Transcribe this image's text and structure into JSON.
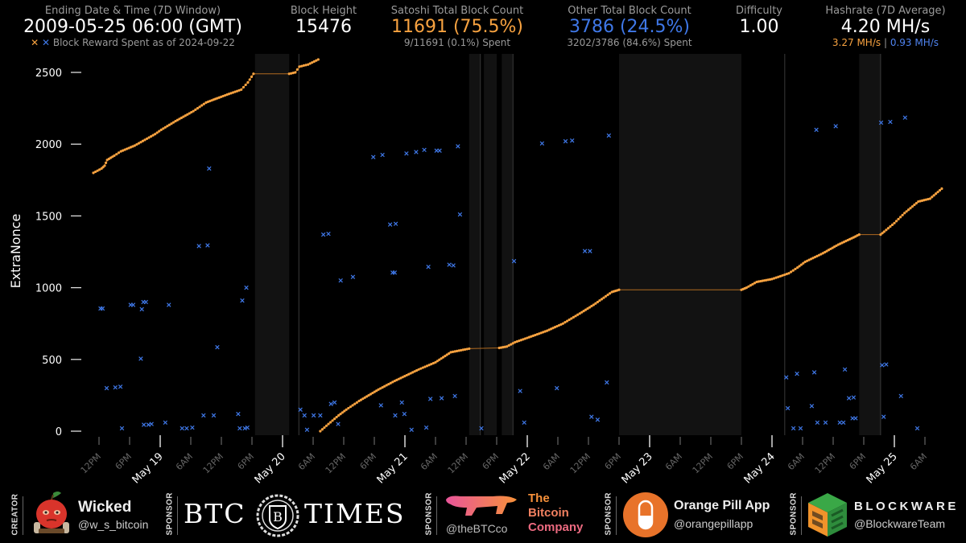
{
  "header": {
    "ending": {
      "label": "Ending Date & Time (7D Window)",
      "value": "2009-05-25 06:00 (GMT)",
      "legend": "Block Reward Spent as of 2024-09-22"
    },
    "block_height": {
      "label": "Block Height",
      "value": "15476"
    },
    "satoshi": {
      "label": "Satoshi Total Block Count",
      "value": "11691 (75.5%)",
      "sub": "9/11691 (0.1%) Spent"
    },
    "other": {
      "label": "Other Total Block Count",
      "value": "3786 (24.5%)",
      "sub": "3202/3786 (84.6%) Spent"
    },
    "difficulty": {
      "label": "Difficulty",
      "value": "1.00"
    },
    "hashrate": {
      "label": "Hashrate (7D Average)",
      "value": "4.20 MH/s",
      "satoshi": "3.27 MH/s",
      "separator": "|",
      "other": "0.93 MH/s"
    }
  },
  "colors": {
    "satoshi": "#f7a240",
    "other": "#3f78e8",
    "band": "#121212",
    "background": "#000000"
  },
  "chart_data": {
    "type": "scatter",
    "title": "",
    "xlabel": "",
    "ylabel": "ExtraNonce",
    "ylim": [
      0,
      2500
    ],
    "yticks": [
      0,
      500,
      1000,
      1500,
      2000,
      2500
    ],
    "x_units": "hours since 2009-05-19 00:00 GMT",
    "xlim": [
      -18,
      156
    ],
    "xticks_major": [
      {
        "h": 0,
        "label": "May 19"
      },
      {
        "h": 24,
        "label": "May 20"
      },
      {
        "h": 48,
        "label": "May 21"
      },
      {
        "h": 72,
        "label": "May 22"
      },
      {
        "h": 96,
        "label": "May 23"
      },
      {
        "h": 120,
        "label": "May 24"
      },
      {
        "h": 144,
        "label": "May 25"
      }
    ],
    "xticks_minor": [
      {
        "h": -12,
        "label": "12PM"
      },
      {
        "h": -6,
        "label": "6PM"
      },
      {
        "h": 6,
        "label": "6AM"
      },
      {
        "h": 12,
        "label": "12PM"
      },
      {
        "h": 18,
        "label": "6PM"
      },
      {
        "h": 30,
        "label": "6AM"
      },
      {
        "h": 36,
        "label": "12PM"
      },
      {
        "h": 42,
        "label": "6PM"
      },
      {
        "h": 54,
        "label": "6AM"
      },
      {
        "h": 60,
        "label": "12PM"
      },
      {
        "h": 66,
        "label": "6PM"
      },
      {
        "h": 78,
        "label": "6AM"
      },
      {
        "h": 84,
        "label": "12PM"
      },
      {
        "h": 90,
        "label": "6PM"
      },
      {
        "h": 102,
        "label": "6AM"
      },
      {
        "h": 108,
        "label": "12PM"
      },
      {
        "h": 114,
        "label": "6PM"
      },
      {
        "h": 126,
        "label": "6AM"
      },
      {
        "h": 132,
        "label": "12PM"
      },
      {
        "h": 138,
        "label": "6PM"
      },
      {
        "h": 150,
        "label": "6AM"
      }
    ],
    "gap_bands": [
      [
        18.6,
        25.3
      ],
      [
        60.6,
        62.7
      ],
      [
        63.5,
        66.0
      ],
      [
        67.0,
        69.2
      ],
      [
        90.0,
        114.0
      ],
      [
        137.1,
        141.3
      ]
    ],
    "vertical_lines": [
      27.2,
      62.8,
      69.2,
      122.5,
      141.3
    ],
    "series": [
      {
        "name": "Satoshi",
        "marker": "dot",
        "color": "#f7a240",
        "segments": [
          [
            [
              -13.1,
              1800
            ],
            [
              -11.5,
              1830
            ],
            [
              -10.9,
              1850
            ],
            [
              -10.4,
              1890
            ],
            [
              -9,
              1920
            ],
            [
              -7.7,
              1950
            ],
            [
              -5,
              1990
            ],
            [
              -3.0,
              2030
            ],
            [
              -1,
              2070
            ],
            [
              0.2,
              2100
            ],
            [
              3,
              2160
            ],
            [
              6.5,
              2230
            ],
            [
              9,
              2290
            ],
            [
              11.2,
              2320
            ],
            [
              13.5,
              2350
            ],
            [
              15.9,
              2380
            ],
            [
              17.2,
              2430
            ],
            [
              18.3,
              2490
            ],
            [
              25.3,
              2490
            ],
            [
              26.5,
              2500
            ],
            [
              27.3,
              2540
            ],
            [
              29,
              2555
            ],
            [
              31.0,
              2590
            ]
          ],
          [
            [
              31.4,
              0
            ],
            [
              33,
              50
            ],
            [
              35,
              110
            ],
            [
              36.5,
              150
            ],
            [
              39,
              210
            ],
            [
              42.8,
              290
            ],
            [
              46,
              350
            ],
            [
              50.7,
              430
            ],
            [
              54,
              480
            ],
            [
              57.0,
              550
            ],
            [
              60.6,
              575
            ],
            [
              66.5,
              580
            ],
            [
              68,
              590
            ],
            [
              69.6,
              620
            ],
            [
              72,
              650
            ],
            [
              75.9,
              700
            ],
            [
              79,
              750
            ],
            [
              82.3,
              820
            ],
            [
              85,
              880
            ],
            [
              88.6,
              970
            ],
            [
              90.0,
              985
            ],
            [
              114.0,
              985
            ],
            [
              115,
              1000
            ],
            [
              117,
              1040
            ],
            [
              120,
              1060
            ],
            [
              123.3,
              1100
            ],
            [
              125,
              1140
            ],
            [
              126.5,
              1180
            ],
            [
              130,
              1240
            ],
            [
              133,
              1300
            ],
            [
              136,
              1350
            ],
            [
              137.1,
              1370
            ],
            [
              141.3,
              1370
            ],
            [
              142,
              1390
            ],
            [
              144,
              1450
            ],
            [
              146,
              1520
            ],
            [
              148.7,
              1600
            ],
            [
              151,
              1620
            ],
            [
              153.3,
              1690
            ]
          ]
        ]
      },
      {
        "name": "Other",
        "marker": "x",
        "color": "#3f78e8",
        "points": [
          [
            -11.7,
            855
          ],
          [
            -11.3,
            855
          ],
          [
            -10.5,
            300
          ],
          [
            -8.8,
            305
          ],
          [
            -7.8,
            310
          ],
          [
            -7.5,
            20
          ],
          [
            -5.8,
            880
          ],
          [
            -5.3,
            880
          ],
          [
            -3.8,
            505
          ],
          [
            -3.6,
            850
          ],
          [
            -3.3,
            900
          ],
          [
            -3.2,
            45
          ],
          [
            -2.8,
            900
          ],
          [
            -2.3,
            45
          ],
          [
            -1.7,
            50
          ],
          [
            1,
            60
          ],
          [
            1.7,
            880
          ],
          [
            4.3,
            20
          ],
          [
            5.2,
            20
          ],
          [
            6.3,
            25
          ],
          [
            7.6,
            1290
          ],
          [
            8.5,
            110
          ],
          [
            9.3,
            1295
          ],
          [
            9.6,
            1830
          ],
          [
            10.5,
            110
          ],
          [
            11.2,
            585
          ],
          [
            15.3,
            120
          ],
          [
            15.6,
            20
          ],
          [
            16.1,
            910
          ],
          [
            16.6,
            20
          ],
          [
            16.9,
            1000
          ],
          [
            17.1,
            25
          ],
          [
            27.5,
            150
          ],
          [
            28.3,
            110
          ],
          [
            28.8,
            10
          ],
          [
            30.1,
            110
          ],
          [
            31.4,
            110
          ],
          [
            32,
            1370
          ],
          [
            33,
            1375
          ],
          [
            33.5,
            190
          ],
          [
            34.2,
            200
          ],
          [
            35.4,
            1050
          ],
          [
            34.9,
            50
          ],
          [
            37.8,
            1075
          ],
          [
            41.8,
            1910
          ],
          [
            43.3,
            180
          ],
          [
            43.6,
            1925
          ],
          [
            45.1,
            1440
          ],
          [
            45.6,
            1105
          ],
          [
            46.0,
            1105
          ],
          [
            46.1,
            110
          ],
          [
            46.2,
            1445
          ],
          [
            47.4,
            200
          ],
          [
            47.9,
            120
          ],
          [
            48.3,
            1935
          ],
          [
            49.3,
            10
          ],
          [
            50.2,
            1945
          ],
          [
            51.8,
            1960
          ],
          [
            52.2,
            25
          ],
          [
            52.6,
            1145
          ],
          [
            53,
            225
          ],
          [
            54.2,
            1955
          ],
          [
            54.8,
            1955
          ],
          [
            55.2,
            230
          ],
          [
            56.7,
            1160
          ],
          [
            57.5,
            1155
          ],
          [
            57.8,
            245
          ],
          [
            58.4,
            1985
          ],
          [
            58.8,
            1510
          ],
          [
            63.0,
            20
          ],
          [
            69.4,
            1185
          ],
          [
            70.6,
            280
          ],
          [
            71.4,
            60
          ],
          [
            74.9,
            2005
          ],
          [
            77.8,
            300
          ],
          [
            79.5,
            2020
          ],
          [
            80.8,
            2025
          ],
          [
            83.3,
            1255
          ],
          [
            84.3,
            1255
          ],
          [
            84.6,
            100
          ],
          [
            85.8,
            80
          ],
          [
            87.6,
            340
          ],
          [
            88.0,
            2060
          ],
          [
            122.8,
            375
          ],
          [
            123.1,
            160
          ],
          [
            124.2,
            20
          ],
          [
            124.9,
            400
          ],
          [
            125.6,
            20
          ],
          [
            127.8,
            175
          ],
          [
            128.3,
            410
          ],
          [
            128.7,
            2100
          ],
          [
            128.9,
            60
          ],
          [
            130.5,
            60
          ],
          [
            132.5,
            2125
          ],
          [
            133.3,
            60
          ],
          [
            134.0,
            60
          ],
          [
            134.3,
            430
          ],
          [
            135.1,
            230
          ],
          [
            135.8,
            90
          ],
          [
            136.0,
            235
          ],
          [
            136.4,
            90
          ],
          [
            141.4,
            2150
          ],
          [
            141.6,
            460
          ],
          [
            141.9,
            100
          ],
          [
            142.4,
            465
          ],
          [
            143.2,
            2155
          ],
          [
            145.3,
            245
          ],
          [
            146.1,
            2185
          ],
          [
            148.5,
            20
          ]
        ]
      }
    ]
  },
  "footer": {
    "creator": {
      "role": "CREATOR",
      "name": "Wicked",
      "handle": "@w_s_bitcoin"
    },
    "sponsors": [
      {
        "role": "SPONSOR",
        "name": "BTC TIMES",
        "handle": ""
      },
      {
        "role": "SPONSOR",
        "name": "The Bitcoin Company",
        "name_lines": [
          "The",
          "Bitcoin",
          "Company"
        ],
        "handle": "@theBTCco"
      },
      {
        "role": "SPONSOR",
        "name": "Orange Pill App",
        "handle": "@orangepillapp"
      },
      {
        "role": "SPONSOR",
        "name": "BLOCKWARE",
        "handle": "@BlockwareTeam"
      }
    ],
    "btc_times_left": "BTC",
    "btc_times_right": "TIMES",
    "btc_times_emblem": "B"
  }
}
